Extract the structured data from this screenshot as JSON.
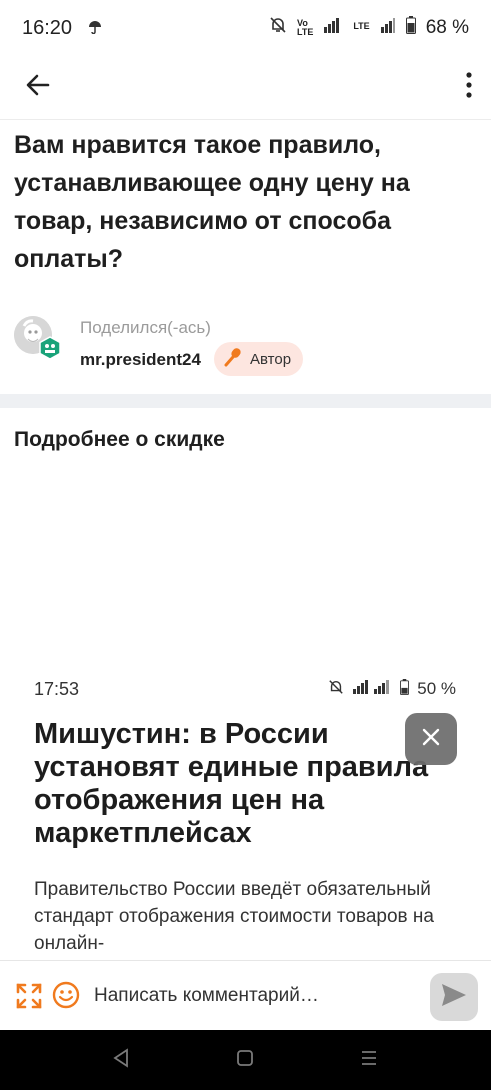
{
  "status_bar": {
    "time": "16:20",
    "lte_label": "LTE",
    "volte_top": "Vo",
    "volte_bottom": "LTE",
    "battery": "68 %"
  },
  "app_bar": {},
  "post": {
    "title": "Вам нравится такое правило, устанавливающее одну цену на товар, независимо от способа оплаты?",
    "shared_label": "Поделился(-ась)",
    "username": "mr.president24",
    "author_badge": "Автор"
  },
  "section": {
    "title": "Подробнее о скидке"
  },
  "embedded_screenshot": {
    "status_time": "17:53",
    "status_battery": "50 %",
    "headline": "Мишустин: в России установят единые правила отображения цен на маркетплейсах",
    "body": "Правительство России введёт обязательный стандарт отображения стоимости товаров на онлайн-"
  },
  "comment_bar": {
    "placeholder": "Написать комментарий…"
  },
  "colors": {
    "accent_orange": "#f07a1e",
    "badge_bg": "#fde6e0",
    "avatar_badge_green": "#1aa37a"
  }
}
